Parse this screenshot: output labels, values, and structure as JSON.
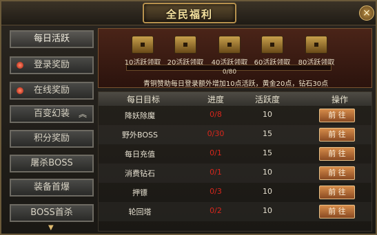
{
  "window": {
    "title": "全民福利",
    "close_icon": "×"
  },
  "sidebar": {
    "items": [
      {
        "label": "每日活跃",
        "dot": false,
        "chevron": false
      },
      {
        "label": "登录奖励",
        "dot": true,
        "chevron": false
      },
      {
        "label": "在线奖励",
        "dot": true,
        "chevron": false
      },
      {
        "label": "百变幻装",
        "dot": false,
        "chevron": true
      },
      {
        "label": "积分奖励",
        "dot": false,
        "chevron": false
      },
      {
        "label": "屠杀BOSS",
        "dot": false,
        "chevron": false
      },
      {
        "label": "装备首爆",
        "dot": false,
        "chevron": false
      },
      {
        "label": "BOSS首杀",
        "dot": false,
        "chevron": false
      }
    ],
    "chevron_icon": "︽",
    "scroll_icon": "▼"
  },
  "rewards": {
    "chests": [
      "10活跃领取",
      "20活跃领取",
      "40活跃领取",
      "60活跃领取",
      "80活跃领取"
    ],
    "progress_text": "0/80",
    "progress_value": 0,
    "tip": "青铜赞助每日登录额外增加10点活跃，黄金20点，钻石30点"
  },
  "table": {
    "headers": [
      "每日目标",
      "进度",
      "活跃度",
      "操作"
    ],
    "rows": [
      {
        "goal": "降妖除魔",
        "progress": "0/8",
        "points": "10",
        "action": "前 往"
      },
      {
        "goal": "野外BOSS",
        "progress": "0/30",
        "points": "15",
        "action": "前 往"
      },
      {
        "goal": "每日充值",
        "progress": "0/1",
        "points": "15",
        "action": "前 往"
      },
      {
        "goal": "消费钻石",
        "progress": "0/1",
        "points": "10",
        "action": "前 往"
      },
      {
        "goal": "押镖",
        "progress": "0/3",
        "points": "10",
        "action": "前 往"
      },
      {
        "goal": "轮回塔",
        "progress": "0/2",
        "points": "10",
        "action": "前 往"
      }
    ]
  },
  "colors": {
    "accent": "#e0bb70",
    "progress_red": "#d8261c"
  }
}
